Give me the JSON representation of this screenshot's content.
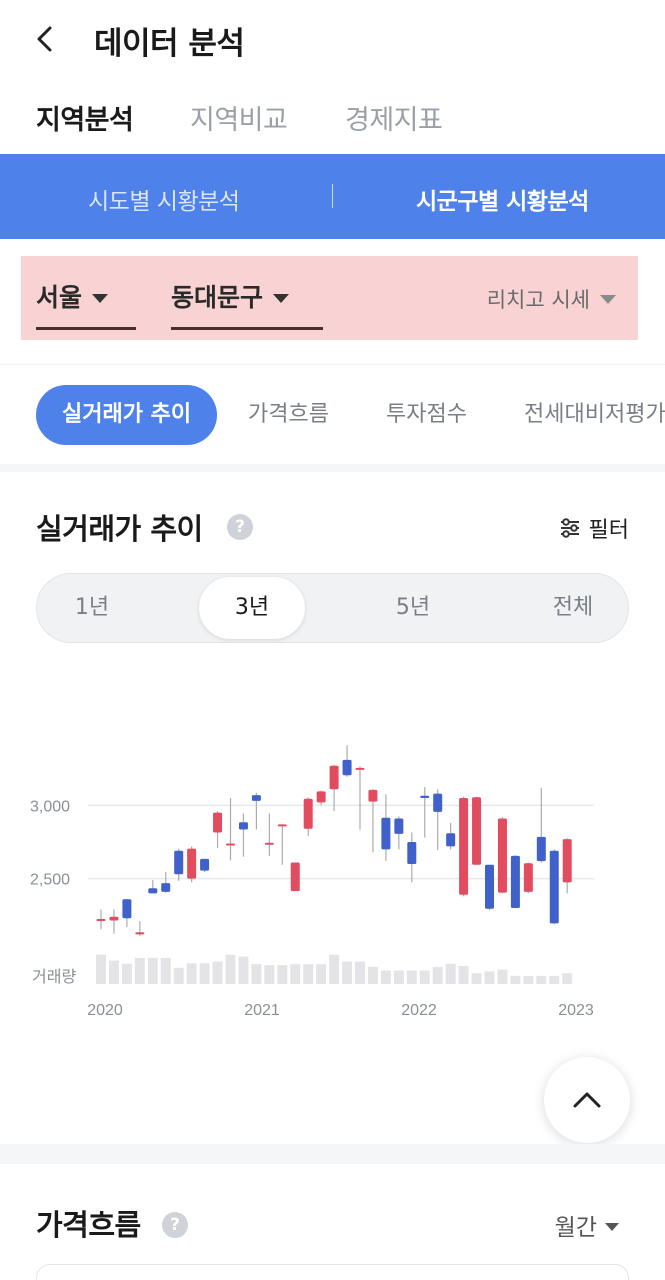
{
  "header": {
    "title": "데이터 분석"
  },
  "main_tabs": [
    {
      "label": "지역분석",
      "active": true
    },
    {
      "label": "지역비교",
      "active": false
    },
    {
      "label": "경제지표",
      "active": false
    }
  ],
  "sub_tabs": [
    {
      "label": "시도별 시황분석",
      "active": false
    },
    {
      "label": "시군구별 시황분석",
      "active": true
    }
  ],
  "selectors": {
    "city": "서울",
    "district": "동대문구",
    "price_type": "리치고 시세"
  },
  "section_tabs": [
    {
      "label": "실거래가 추이",
      "active": true
    },
    {
      "label": "가격흐름",
      "active": false
    },
    {
      "label": "투자점수",
      "active": false
    },
    {
      "label": "전세대비저평가",
      "active": false
    }
  ],
  "chart_section": {
    "title": "실거래가 추이",
    "help": "?",
    "filter_label": "필터",
    "periods": [
      {
        "label": "1년",
        "active": false
      },
      {
        "label": "3년",
        "active": true
      },
      {
        "label": "5년",
        "active": false
      },
      {
        "label": "전체",
        "active": false
      }
    ]
  },
  "chart_data": {
    "type": "candlestick",
    "title": "",
    "xlabel": "",
    "ylabel": "",
    "x_ticks": [
      "2020",
      "2021",
      "2022",
      "2023"
    ],
    "y_ticks": [
      {
        "value": 3000,
        "label": "3,000"
      },
      {
        "value": 2500,
        "label": "2,500"
      }
    ],
    "volume_label": "거래량",
    "ylim": [
      2000,
      3500
    ],
    "colors": {
      "up": "#e34b5f",
      "down": "#3f61c9",
      "volume": "#e4e4e8"
    },
    "candles": [
      {
        "open": 2225,
        "close": 2225,
        "high": 2290,
        "low": 2155,
        "volume": 0.65
      },
      {
        "open": 2215,
        "close": 2240,
        "high": 2290,
        "low": 2125,
        "volume": 0.52
      },
      {
        "open": 2360,
        "close": 2230,
        "high": 2360,
        "low": 2170,
        "volume": 0.45
      },
      {
        "open": 2120,
        "close": 2135,
        "high": 2210,
        "low": 2110,
        "volume": 0.58
      },
      {
        "open": 2435,
        "close": 2400,
        "high": 2490,
        "low": 2400,
        "volume": 0.58
      },
      {
        "open": 2470,
        "close": 2410,
        "high": 2545,
        "low": 2405,
        "volume": 0.58
      },
      {
        "open": 2690,
        "close": 2530,
        "high": 2705,
        "low": 2485,
        "volume": 0.36
      },
      {
        "open": 2500,
        "close": 2705,
        "high": 2720,
        "low": 2475,
        "volume": 0.46
      },
      {
        "open": 2635,
        "close": 2555,
        "high": 2635,
        "low": 2545,
        "volume": 0.46
      },
      {
        "open": 2815,
        "close": 2950,
        "high": 2960,
        "low": 2710,
        "volume": 0.5
      },
      {
        "open": 2730,
        "close": 2740,
        "high": 3050,
        "low": 2625,
        "volume": 0.65
      },
      {
        "open": 2885,
        "close": 2835,
        "high": 2945,
        "low": 2650,
        "volume": 0.61
      },
      {
        "open": 3070,
        "close": 3030,
        "high": 3085,
        "low": 2835,
        "volume": 0.44
      },
      {
        "open": 2740,
        "close": 2745,
        "high": 2945,
        "low": 2655,
        "volume": 0.42
      },
      {
        "open": 2865,
        "close": 2870,
        "high": 2860,
        "low": 2595,
        "volume": 0.42
      },
      {
        "open": 2415,
        "close": 2610,
        "high": 2605,
        "low": 2420,
        "volume": 0.44
      },
      {
        "open": 2840,
        "close": 3045,
        "high": 3055,
        "low": 2790,
        "volume": 0.44
      },
      {
        "open": 3020,
        "close": 3095,
        "high": 3100,
        "low": 3000,
        "volume": 0.44
      },
      {
        "open": 3110,
        "close": 3270,
        "high": 3275,
        "low": 2960,
        "volume": 0.65
      },
      {
        "open": 3310,
        "close": 3205,
        "high": 3410,
        "low": 3195,
        "volume": 0.5
      },
      {
        "open": 3245,
        "close": 3255,
        "high": 3265,
        "low": 2835,
        "volume": 0.5
      },
      {
        "open": 3025,
        "close": 3105,
        "high": 3110,
        "low": 2680,
        "volume": 0.38
      },
      {
        "open": 2915,
        "close": 2700,
        "high": 3075,
        "low": 2620,
        "volume": 0.3
      },
      {
        "open": 2910,
        "close": 2805,
        "high": 2925,
        "low": 2700,
        "volume": 0.3
      },
      {
        "open": 2750,
        "close": 2600,
        "high": 2815,
        "low": 2475,
        "volume": 0.3
      },
      {
        "open": 3065,
        "close": 3050,
        "high": 3125,
        "low": 2780,
        "volume": 0.3
      },
      {
        "open": 3080,
        "close": 2955,
        "high": 3110,
        "low": 2695,
        "volume": 0.38
      },
      {
        "open": 2810,
        "close": 2720,
        "high": 2880,
        "low": 2700,
        "volume": 0.45
      },
      {
        "open": 2390,
        "close": 3050,
        "high": 3060,
        "low": 2380,
        "volume": 0.4
      },
      {
        "open": 2595,
        "close": 3055,
        "high": 3060,
        "low": 2595,
        "volume": 0.24
      },
      {
        "open": 2595,
        "close": 2295,
        "high": 2590,
        "low": 2285,
        "volume": 0.28
      },
      {
        "open": 2405,
        "close": 2910,
        "high": 2920,
        "low": 2400,
        "volume": 0.32
      },
      {
        "open": 2655,
        "close": 2300,
        "high": 2660,
        "low": 2300,
        "volume": 0.18
      },
      {
        "open": 2410,
        "close": 2605,
        "high": 2610,
        "low": 2400,
        "volume": 0.18
      },
      {
        "open": 2785,
        "close": 2620,
        "high": 3120,
        "low": 2610,
        "volume": 0.18
      },
      {
        "open": 2690,
        "close": 2195,
        "high": 2700,
        "low": 2190,
        "volume": 0.18
      },
      {
        "open": 2475,
        "close": 2770,
        "high": 2775,
        "low": 2400,
        "volume": 0.24
      }
    ]
  },
  "price_section": {
    "title": "가격흐름",
    "help": "?",
    "period": "월간"
  }
}
